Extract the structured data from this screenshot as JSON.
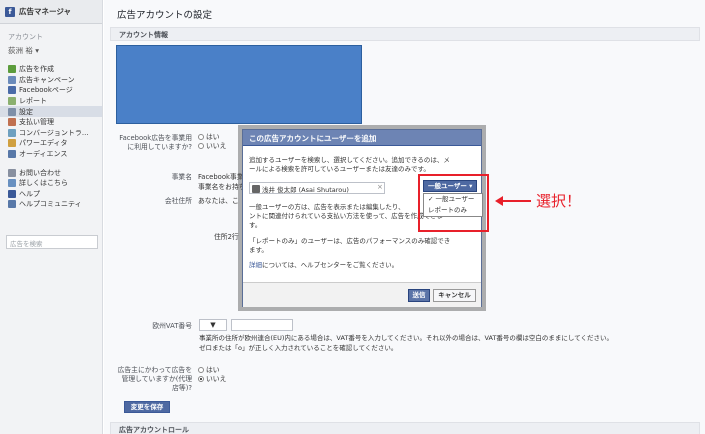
{
  "app": {
    "title": "広告マネージャ"
  },
  "sidebar": {
    "account_label": "アカウント",
    "user_name": "荻洲 裕",
    "menu1": [
      {
        "label": "広告を作成",
        "icon_color": "#5c9c3c"
      },
      {
        "label": "広告キャンペーン",
        "icon_color": "#6b8bbb"
      },
      {
        "label": "Facebookページ",
        "icon_color": "#4a6ba8"
      },
      {
        "label": "レポート",
        "icon_color": "#8bb06f"
      },
      {
        "label": "設定",
        "icon_color": "#7e8fa8"
      },
      {
        "label": "支払い管理",
        "icon_color": "#c07050"
      },
      {
        "label": "コンバージョントラ...",
        "icon_color": "#6ea0c0"
      },
      {
        "label": "パワーエディタ",
        "icon_color": "#d0a040"
      },
      {
        "label": "オーディエンス",
        "icon_color": "#5878a8"
      }
    ],
    "menu2": [
      {
        "label": "お問い合わせ",
        "icon_color": "#8890a0"
      },
      {
        "label": "詳しくはこちら",
        "icon_color": "#6890c0"
      },
      {
        "label": "ヘルプ",
        "icon_color": "#3b5998"
      },
      {
        "label": "ヘルプコミュニティ",
        "icon_color": "#5878a8"
      }
    ],
    "search_placeholder": "広告を検索"
  },
  "main": {
    "page_title": "広告アカウントの設定",
    "section_account_info": "アカウント情報",
    "business_use_label": "Facebook広告を事業用に利用していますか?",
    "yes": "はい",
    "no": "いいえ",
    "business_name_label": "事業名",
    "business_name_value": "Facebook事業",
    "business_name_hint": "事業名をお持ち",
    "address_label": "会社住所",
    "address_value": "あなたは、こ",
    "address_line2_label": "住所2行",
    "vat_label": "欧州VAT番号",
    "vat_select": "▼",
    "vat_help_1": "事業所の住所が欧州連合(EU)内にある場合は、VAT番号を入力してください。それ以外の場合は、VAT番号の欄は空白のままにしてください。",
    "vat_help_2": "ゼロまたは「o」が正しく入力されていることを確認してください。",
    "agency_label": "広告主にかわって広告を管理していますか(代理店等)?",
    "save_label": "変更を保存",
    "section_roles": "広告アカウントロール"
  },
  "dialog": {
    "title": "この広告アカウントにユーザーを追加",
    "intro_1": "追加するユーザーを検索し、選択してください。追加できるのは、メ",
    "intro_2": "ールによる検索を許可しているユーザーまたは友達のみです。",
    "user_token": "浅井 俊太郎 (Asai Shutarou)",
    "token_remove": "×",
    "general_1": "一般ユーザーの方は、広告を表示または編集したり、",
    "general_2": "ントに関連付けられている支払い方法を使って、広告を作成できま",
    "general_3": "す。",
    "report_1": "「レポートのみ」のユーザーは、広告のパフォーマンスのみ確認でき",
    "report_2": "ます。",
    "help_link": "詳細",
    "help_rest": "については、ヘルプセンターをご覧ください。",
    "send_label": "送信",
    "cancel_label": "キャンセル"
  },
  "role_dropdown": {
    "selected": "一般ユーザー ▾",
    "options": [
      "✓ 一般ユーザー",
      "レポートのみ"
    ]
  },
  "annotation": {
    "text": "選択！",
    "color": "#e8202a"
  }
}
